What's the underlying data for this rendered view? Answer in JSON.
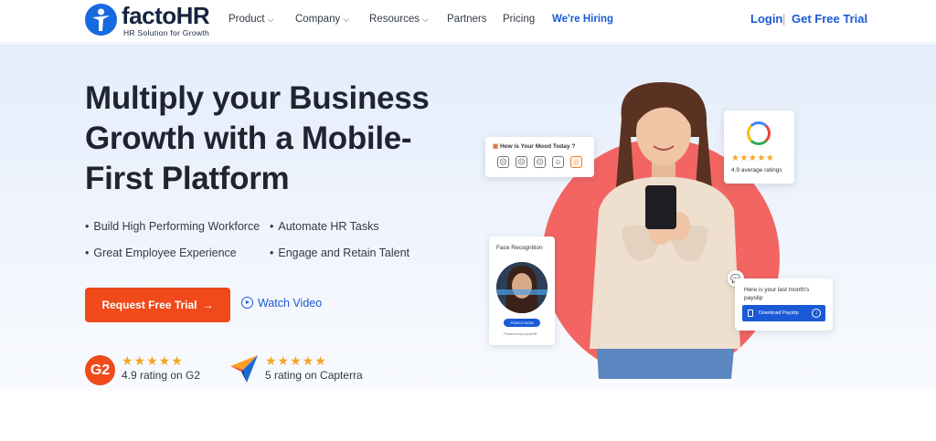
{
  "brand": {
    "name_part1": "facto",
    "name_part2": "HR",
    "tagline": "HR Solution for Growth"
  },
  "nav": {
    "items": [
      {
        "label": "Product",
        "dropdown": true
      },
      {
        "label": "Company",
        "dropdown": true
      },
      {
        "label": "Resources",
        "dropdown": true
      },
      {
        "label": "Partners",
        "dropdown": false
      },
      {
        "label": "Pricing",
        "dropdown": false
      },
      {
        "label": "We're Hiring",
        "dropdown": false
      }
    ],
    "login": "Login",
    "separator": "|",
    "cta": "Get Free Trial"
  },
  "hero": {
    "headline": "Multiply your Business Growth with a Mobile-First Platform",
    "bullets": [
      "Build High Performing Workforce",
      "Automate HR Tasks",
      "Great Employee Experience",
      "Engage and Retain Talent"
    ],
    "primary_cta": "Request Free Trial",
    "primary_cta_arrow": "→",
    "secondary_cta": "Watch Video"
  },
  "ratings": [
    {
      "source_logo": "G2",
      "stars": "★★★★★",
      "text": "4.9 rating on G2"
    },
    {
      "source_logo": "capterra-icon",
      "stars": "★★★★★",
      "text": "5 rating on Capterra"
    }
  ],
  "illustration": {
    "mood_card": {
      "title": "How is Your Mood Today ?",
      "faces": [
        "☹",
        "☹",
        "☹",
        "☺",
        "☺"
      ],
      "selected_index": 4
    },
    "google_card": {
      "stars": "★★★★★",
      "text": "4.9 average ratings"
    },
    "face_card": {
      "title": "Face Recognition",
      "button": "PUNCH NOW",
      "powered": "Powered by factoHR"
    },
    "payslip_card": {
      "title": "Here is your last month's payslip",
      "button": "Download Payslip"
    }
  },
  "colors": {
    "brand_blue": "#1a5ad6",
    "cta_orange": "#f04a1b",
    "circle_red": "#f26563",
    "star_gold": "#f5a623"
  }
}
